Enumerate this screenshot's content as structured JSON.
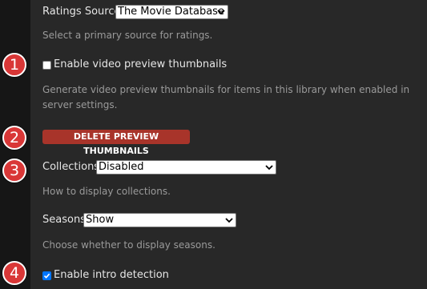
{
  "settings": {
    "ratings_source": {
      "label": "Ratings Source",
      "value": "The Movie Database",
      "help": "Select a primary source for ratings."
    },
    "video_preview": {
      "label": "Enable video preview thumbnails",
      "checked": false,
      "help": "Generate video preview thumbnails for items in this library when enabled in server settings."
    },
    "delete_previews": {
      "label": "DELETE PREVIEW THUMBNAILS"
    },
    "collections": {
      "label": "Collections",
      "value": "Disabled",
      "help": "How to display collections."
    },
    "seasons": {
      "label": "Seasons",
      "value": "Show",
      "help": "Choose whether to display seasons."
    },
    "intro_detection": {
      "label": "Enable intro detection",
      "checked": true
    }
  },
  "markers": [
    "1",
    "2",
    "3",
    "4"
  ],
  "icons": {
    "dropdown": "chevron-down-icon",
    "check": "checkmark-icon"
  },
  "colors": {
    "background": "#282828",
    "sidebar": "#161616",
    "danger_button": "#a8342a",
    "marker": "#d93737",
    "checkbox_checked": "#0075ff"
  }
}
